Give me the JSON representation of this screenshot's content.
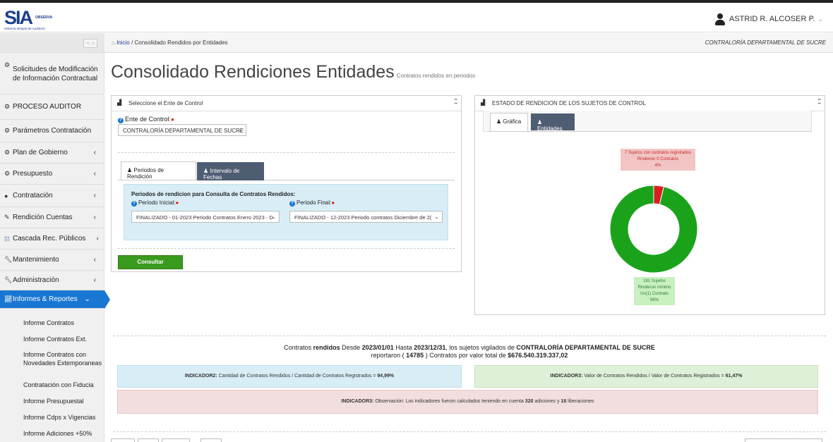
{
  "header": {
    "logo_main": "SIA",
    "logo_obs": "OBSERVA",
    "logo_sub": "Sistema Integral de Auditoría",
    "user_name": "ASTRID R. ALCOSER P.",
    "user_chevron": "⌄"
  },
  "sidebar": {
    "collapse_label": "< >",
    "items": [
      {
        "label": "Solicitudes de Modificación de Información Contractual",
        "icon": "cogs-icon",
        "arrow": ""
      },
      {
        "label": "PROCESO AUDITOR",
        "icon": "cogs-icon",
        "arrow": ""
      },
      {
        "label": "Parámetros Contratación",
        "icon": "cogs-icon",
        "arrow": ""
      },
      {
        "label": "Plan de Gobierno",
        "icon": "cogs-icon",
        "arrow": "‹"
      },
      {
        "label": "Presupuesto",
        "icon": "cogs-icon",
        "arrow": "‹"
      },
      {
        "label": "Contratación",
        "icon": "circle-icon",
        "arrow": "‹"
      },
      {
        "label": "Rendición Cuentas",
        "icon": "edit-icon",
        "arrow": "‹"
      },
      {
        "label": "Cascada Rec. Públicos",
        "icon": "grid-icon",
        "arrow": "‹"
      },
      {
        "label": "Mantenimiento",
        "icon": "wrench-icon",
        "arrow": "‹"
      },
      {
        "label": "Administración",
        "icon": "wrench-icon",
        "arrow": "‹"
      },
      {
        "label": "Informes & Reportes",
        "icon": "chart-icon",
        "arrow": "⌄"
      }
    ],
    "subitems": [
      "Informe Contratos",
      "Informe Contratos Ext.",
      "Informe Contratos con Novedades Extemporaneas",
      "Contratación con Fiducia",
      "Informe Presupuestal",
      "Informe Cdps x Vigencias",
      "Informe Adiciones +50%"
    ]
  },
  "breadcrumb": {
    "home": "Inicio",
    "separator": "/",
    "current": "Consolidado Rendidos por Entidades",
    "org": "CONTRALORÍA DEPARTAMENTAL DE SUCRE"
  },
  "page": {
    "title": "Consolidado Rendiciones Entidades",
    "subtitle": "Contratos rendidos en periodos"
  },
  "left_panel": {
    "title": "Seleccione el Ente de Control",
    "ente_label": "Ente de Control:",
    "ente_value": "CONTRALORÍA DEPARTAMENTAL DE SUCRE",
    "tab_periodos": "Periodos de Rendición",
    "tab_intervalo": "Intervalo de Fechas",
    "periodos_heading": "Periodos de rendicion para Consulta de Contratos Rendidos:",
    "inicial_label": "Periodo Inicial:",
    "inicial_value": "FINALIZADO - 01-2023 Periodo Contratos Enero 2023 - D",
    "final_label": "Periodo Final:",
    "final_value": "FINALIZADO - 12-2023 Periodo contratos Diciembre de 2(",
    "consultar": "Consultar"
  },
  "right_panel": {
    "title": "ESTADO DE RENDICION DE LOS SUJETOS DE CONTROL",
    "tab_grafica": "Gráfica",
    "tab_entidades": "Entidades"
  },
  "chart_data": {
    "type": "pie",
    "donut": true,
    "categories": [
      "Rindieron mínimo Un(1) Contrato",
      "Rindieron 0 Contratos"
    ],
    "values": [
      181,
      7
    ],
    "percents": [
      96,
      4
    ],
    "colors": [
      "#1aa31a",
      "#d62020"
    ],
    "annotations": [
      {
        "lines": [
          "7 Sujetos con contratos registrados",
          "Rindieron 0 Contratos",
          "4%"
        ],
        "color": "#f2c4c4"
      },
      {
        "lines": [
          "181 Sujetos",
          "Rindieron mínimo",
          "Un(1) Contrato",
          "96%"
        ],
        "color": "#c9f0c0"
      }
    ]
  },
  "summary": {
    "l1_a": "Contratos",
    "l1_b": "rendidos",
    "l1_c": "Desde",
    "l1_d": "2023/01/01",
    "l1_e": "Hasta",
    "l1_f": "2023/12/31",
    "l1_g": ", los sujetos vigilados de",
    "l1_h": "CONTRALORÍA DEPARTAMENTAL DE SUCRE",
    "l2_a": "reportaron (",
    "l2_b": "14785",
    "l2_c": ") Contratos por valor total de",
    "l2_d": "$676.540.319.337,02"
  },
  "indicators": {
    "i2_name": "INDICADOR2:",
    "i2_text": "Cantidad de Contratos Rendidos / Cantidad de Contratos Registrados =",
    "i2_value": "94,99%",
    "i3_name": "INDICADOR3:",
    "i3_text": "Valor de Contratos Rendidos / Valor de Contratos Registrados =",
    "i3_value": "61,47%",
    "obs_name": "INDICADOR3:",
    "obs_a": "Observación: Los indicadores fueron calculados teniendo en cuenta",
    "obs_b": "320",
    "obs_c": "adiciones y",
    "obs_d": "16",
    "obs_e": "liberaciones"
  }
}
